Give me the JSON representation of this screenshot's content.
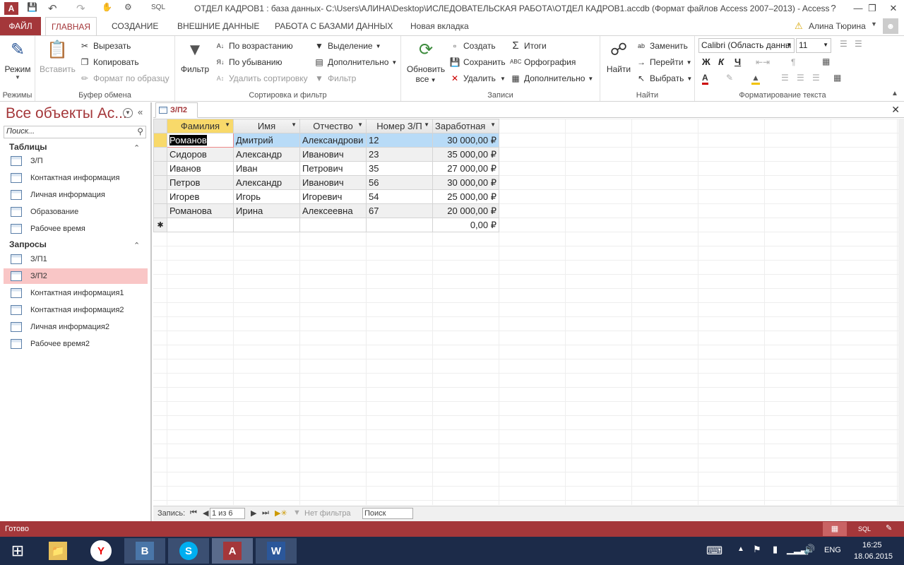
{
  "window": {
    "title": "ОТДЕЛ КАДРОВ1 : база данных- C:\\Users\\АЛИНА\\Desktop\\ИСЛЕДОВАТЕЛЬСКАЯ РАБОТА\\ОТДЕЛ КАДРОВ1.accdb (Формат файлов Access 2007–2013) - Access",
    "qat_sql": "SQL",
    "help": "?"
  },
  "tabs": [
    "ФАЙЛ",
    "ГЛАВНАЯ",
    "СОЗДАНИЕ",
    "ВНЕШНИЕ ДАННЫЕ",
    "РАБОТА С БАЗАМИ ДАННЫХ",
    "Новая вкладка"
  ],
  "user": "Алина Тюрина",
  "ribbon": {
    "views": {
      "mode": "Режим",
      "label": "Режимы"
    },
    "clipboard": {
      "paste": "Вставить",
      "cut": "Вырезать",
      "copy": "Копировать",
      "format_painter": "Формат по образцу",
      "label": "Буфер обмена"
    },
    "sort": {
      "filter": "Фильтр",
      "asc": "По возрастанию",
      "desc": "По убыванию",
      "remove_sort": "Удалить сортировку",
      "selection": "Выделение",
      "advanced": "Дополнительно",
      "toggle_filter": "Фильтр",
      "label": "Сортировка и фильтр"
    },
    "records": {
      "refresh1": "Обновить",
      "refresh2": "все",
      "new": "Создать",
      "save": "Сохранить",
      "delete": "Удалить",
      "totals": "Итоги",
      "spelling": "Орфография",
      "more": "Дополнительно",
      "label": "Записи"
    },
    "find": {
      "find": "Найти",
      "replace": "Заменить",
      "goto": "Перейти",
      "select": "Выбрать",
      "label": "Найти"
    },
    "text": {
      "font": "Calibri (Область данны",
      "size": "11",
      "bold": "Ж",
      "italic": "К",
      "underline": "Ч",
      "label": "Форматирование текста"
    }
  },
  "nav": {
    "header": "Все объекты Ac...",
    "search_placeholder": "Поиск...",
    "tables_label": "Таблицы",
    "tables": [
      "З/П",
      "Контактная информация",
      "Личная информация",
      "Образование",
      "Рабочее время"
    ],
    "queries_label": "Запросы",
    "queries": [
      "З/П1",
      "З/П2",
      "Контактная информация1",
      "Контактная информация2",
      "Личная информация2",
      "Рабочее время2"
    ]
  },
  "doc": {
    "tab": "З/П2"
  },
  "datasheet": {
    "columns": [
      "Фамилия",
      "Имя",
      "Отчество",
      "Номер З/П",
      "Заработная"
    ],
    "rows": [
      [
        "Романов",
        "Дмитрий",
        "Александрови",
        "12",
        "30 000,00 ₽"
      ],
      [
        "Сидоров",
        "Александр",
        "Иванович",
        "23",
        "35 000,00 ₽"
      ],
      [
        "Иванов",
        "Иван",
        "Петрович",
        "35",
        "27 000,00 ₽"
      ],
      [
        "Петров",
        "Александр",
        "Иванович",
        "56",
        "30 000,00 ₽"
      ],
      [
        "Игорев",
        "Игорь",
        "Игоревич",
        "54",
        "25 000,00 ₽"
      ],
      [
        "Романова",
        "Ирина",
        "Алексеевна",
        "67",
        "20 000,00 ₽"
      ]
    ],
    "new_row_marker": "✱",
    "new_row_default": "0,00 ₽"
  },
  "recbar": {
    "label": "Запись:",
    "position": "1 из 6",
    "filter": "Нет фильтра",
    "search": "Поиск"
  },
  "status": {
    "text": "Готово",
    "sql": "SQL"
  },
  "taskbar": {
    "lang": "ENG",
    "time": "16:25",
    "date": "18.06.2015"
  },
  "colors": {
    "accent": "#a4373a",
    "selected_row": "#b8dbf7",
    "header_highlight": "#f8d96a"
  }
}
